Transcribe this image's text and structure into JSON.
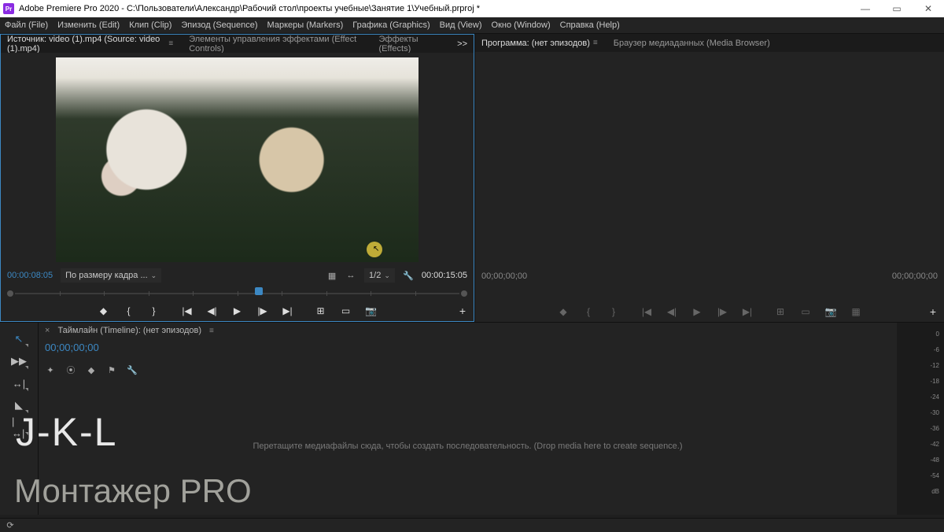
{
  "titlebar": {
    "app_icon_text": "Pr",
    "title": "Adobe Premiere Pro 2020 - C:\\Пользователи\\Александр\\Рабочий стол\\проекты учебные\\Занятие 1\\Учебный.prproj *"
  },
  "menu": {
    "file": "Файл (File)",
    "edit": "Изменить (Edit)",
    "clip": "Клип (Clip)",
    "sequence": "Эпизод (Sequence)",
    "markers": "Маркеры (Markers)",
    "graphics": "Графика (Graphics)",
    "view": "Вид (View)",
    "window": "Окно (Window)",
    "help": "Справка (Help)"
  },
  "source_panel": {
    "tab_source": "Источник: video (1).mp4 (Source: video (1).mp4)",
    "tab_effect_controls": "Элементы управления эффектами (Effect Controls)",
    "tab_effects": "Эффекты (Effects)",
    "more": ">>",
    "time_in": "00:00:08:05",
    "zoom": "По размеру кадра ...",
    "ratio": "1/2",
    "time_out": "00:00:15:05",
    "scrub_position_pct": 54
  },
  "program_panel": {
    "tab_program": "Программа: (нет эпизодов)",
    "tab_mediabrowser": "Браузер медиаданных (Media Browser)",
    "time_in": "00;00;00;00",
    "time_out": "00;00;00;00"
  },
  "timeline": {
    "tab": "Таймлайн (Timeline): (нет эпизодов)",
    "time": "00;00;00;00",
    "drop_msg": "Перетащите медиафайлы сюда, чтобы создать последовательность. (Drop media here to create sequence.)"
  },
  "audio_meter": [
    "0",
    "-6",
    "-12",
    "-18",
    "-24",
    "-30",
    "-36",
    "-42",
    "-48",
    "-54",
    "dB"
  ],
  "overlay": {
    "jkl": "J-K-L",
    "brand": "Монтажер PRO"
  },
  "icons": {
    "threedash": "≡",
    "minimize": "—",
    "maximize": "▭",
    "close": "✕",
    "chev": "⌄",
    "settings_square": "▦",
    "bracket_merge": "↔",
    "wrench": "🔧",
    "marker": "◆",
    "mark_in": "{",
    "mark_out": "}",
    "go_in": "|◀",
    "step_back": "◀|",
    "play": "▶",
    "step_fwd": "|▶",
    "go_out": "▶|",
    "insert": "⊞",
    "overwrite": "▭",
    "camera": "📷",
    "plus": "+",
    "select": "↖",
    "track_select": "▶▶",
    "ripple": "↔|",
    "razor": "◣",
    "slip": "|↔|",
    "refresh": "⟳"
  }
}
